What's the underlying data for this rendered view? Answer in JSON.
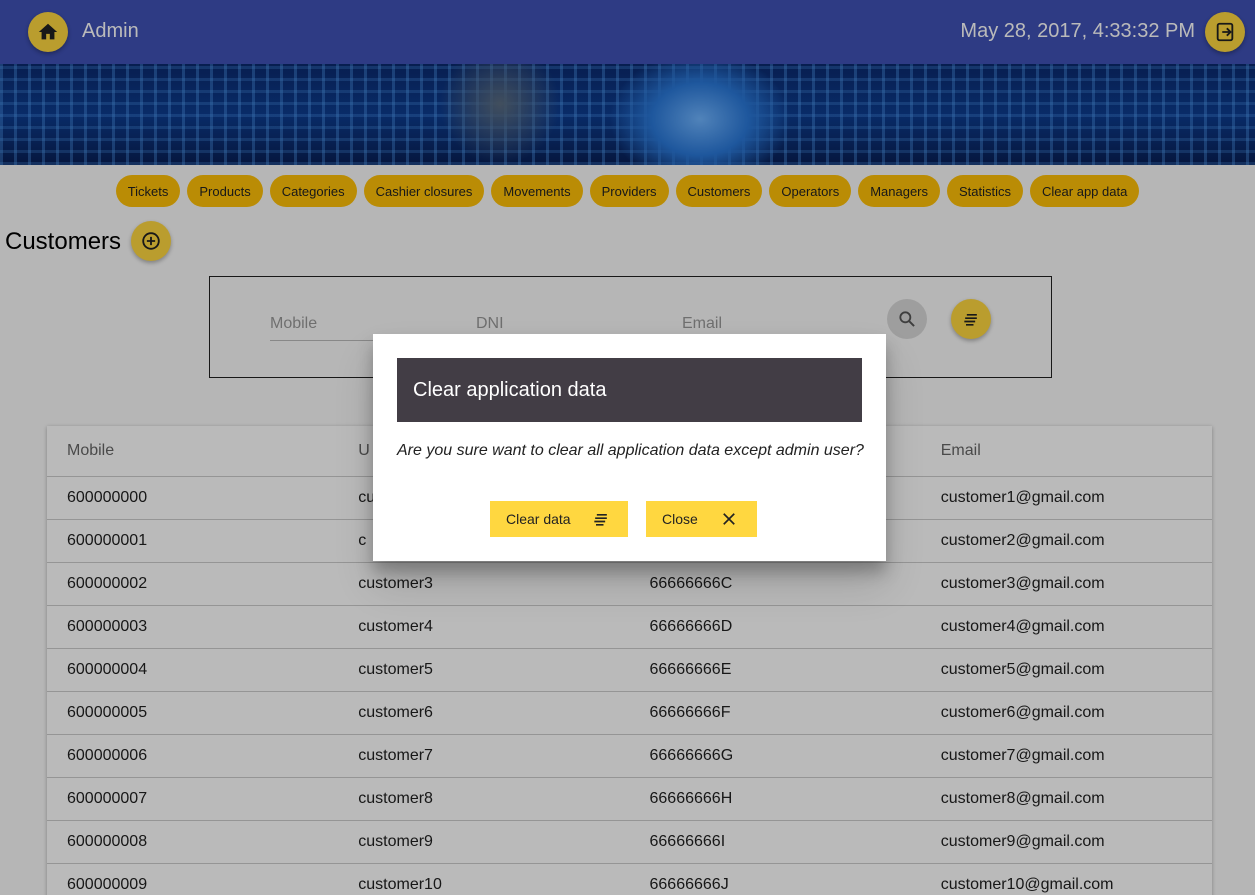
{
  "header": {
    "title": "Admin",
    "datetime": "May 28, 2017, 4:33:32 PM"
  },
  "nav": {
    "items": [
      "Tickets",
      "Products",
      "Categories",
      "Cashier closures",
      "Movements",
      "Providers",
      "Customers",
      "Operators",
      "Managers",
      "Statistics",
      "Clear app data"
    ]
  },
  "page": {
    "title": "Customers"
  },
  "search": {
    "mobile_placeholder": "Mobile",
    "dni_placeholder": "DNI",
    "email_placeholder": "Email"
  },
  "table": {
    "headers": [
      "Mobile",
      "U",
      "",
      "Email"
    ],
    "rows": [
      [
        "600000000",
        "cu",
        "",
        "customer1@gmail.com"
      ],
      [
        "600000001",
        "c",
        "",
        "customer2@gmail.com"
      ],
      [
        "600000002",
        "customer3",
        "66666666C",
        "customer3@gmail.com"
      ],
      [
        "600000003",
        "customer4",
        "66666666D",
        "customer4@gmail.com"
      ],
      [
        "600000004",
        "customer5",
        "66666666E",
        "customer5@gmail.com"
      ],
      [
        "600000005",
        "customer6",
        "66666666F",
        "customer6@gmail.com"
      ],
      [
        "600000006",
        "customer7",
        "66666666G",
        "customer7@gmail.com"
      ],
      [
        "600000007",
        "customer8",
        "66666666H",
        "customer8@gmail.com"
      ],
      [
        "600000008",
        "customer9",
        "66666666I",
        "customer9@gmail.com"
      ],
      [
        "600000009",
        "customer10",
        "66666666J",
        "customer10@gmail.com"
      ]
    ]
  },
  "dialog": {
    "title": "Clear application data",
    "message": "Are you sure want to clear all application data except admin user?",
    "confirm_label": "Clear data",
    "close_label": "Close"
  },
  "colors": {
    "primary": "#3f51b5",
    "accent": "#ffd740",
    "chip": "#ffc107",
    "dialog_header": "#423d45"
  },
  "icons": {
    "home": "home-icon",
    "logout": "exit-to-app-icon",
    "add": "add-circle-outline-icon",
    "search": "search-icon",
    "filter": "sort-lines-icon",
    "close": "close-icon"
  }
}
